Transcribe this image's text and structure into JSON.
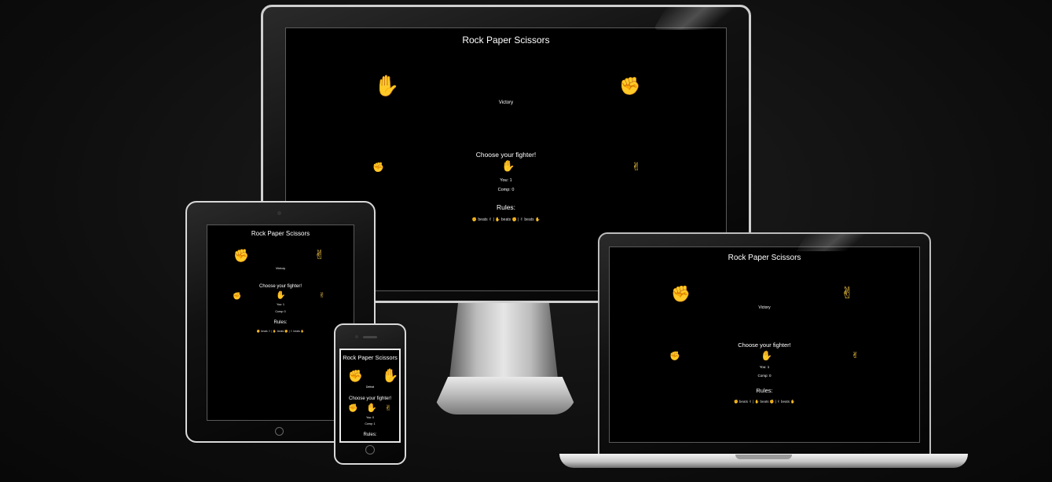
{
  "app": {
    "title": "Rock Paper Scissors",
    "result": "Victory",
    "prompt": "Choose your fighter!",
    "rules_heading": "Rules:",
    "rules_text": "✊ beats ✌ | ✋ beats ✊ | ✌ beats ✋",
    "choices": {
      "rock": "✊",
      "paper": "✋",
      "scissors": "✌"
    }
  },
  "monitor": {
    "player_hand": "✋",
    "computer_hand": "✊",
    "result": "Victory",
    "score_you": "You: 1",
    "score_comp": "Comp: 0"
  },
  "tablet": {
    "player_hand": "✊",
    "computer_hand": "✌",
    "result": "Victory",
    "score_you": "You: 1",
    "score_comp": "Comp: 0"
  },
  "laptop": {
    "player_hand": "✊",
    "computer_hand": "✌",
    "result": "Victory",
    "score_you": "You: 1",
    "score_comp": "Comp: 0"
  },
  "phone": {
    "player_hand": "✊",
    "computer_hand": "✋",
    "result": "Defeat",
    "score_you": "You: 0",
    "score_comp": "Comp: 1"
  },
  "colors": {
    "accent": "#f5c542",
    "background": "#000000",
    "frame": "#d9d9d9"
  }
}
